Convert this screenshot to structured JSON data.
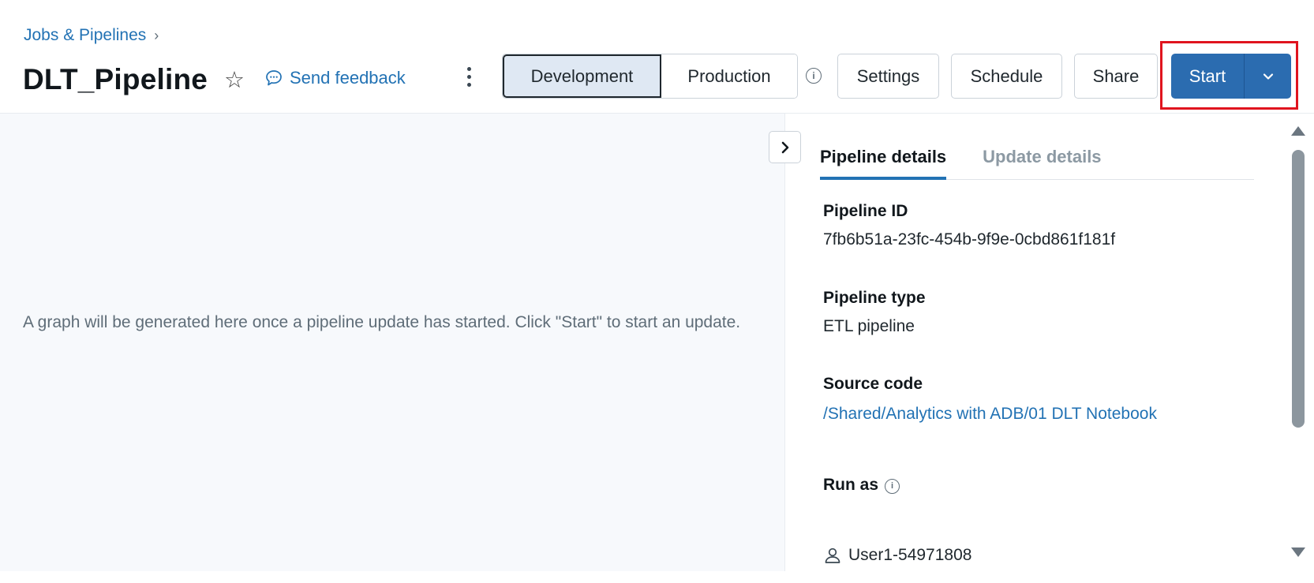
{
  "breadcrumb": {
    "label": "Jobs & Pipelines",
    "separator": "›"
  },
  "header": {
    "title": "DLT_Pipeline",
    "feedback_label": "Send feedback",
    "mode_development": "Development",
    "mode_production": "Production",
    "settings_label": "Settings",
    "schedule_label": "Schedule",
    "share_label": "Share",
    "start_label": "Start"
  },
  "graph": {
    "message": "A graph will be generated here once a pipeline update has started. Click \"Start\" to start an update."
  },
  "panel": {
    "tabs": [
      {
        "label": "Pipeline details",
        "active": true
      },
      {
        "label": "Update details",
        "active": false
      }
    ],
    "pipeline_id_label": "Pipeline ID",
    "pipeline_id_value": "7fb6b51a-23fc-454b-9f9e-0cbd861f181f",
    "pipeline_type_label": "Pipeline type",
    "pipeline_type_value": "ETL pipeline",
    "source_code_label": "Source code",
    "source_code_value": "/Shared/Analytics with ADB/01 DLT Notebook",
    "run_as_label": "Run as",
    "run_as_user": "User1-54971808"
  },
  "colors": {
    "accent": "#2272b4",
    "start_button": "#2b6cb0",
    "highlight_box": "#e0141e",
    "dev_selected_bg": "#dfe8f3"
  }
}
